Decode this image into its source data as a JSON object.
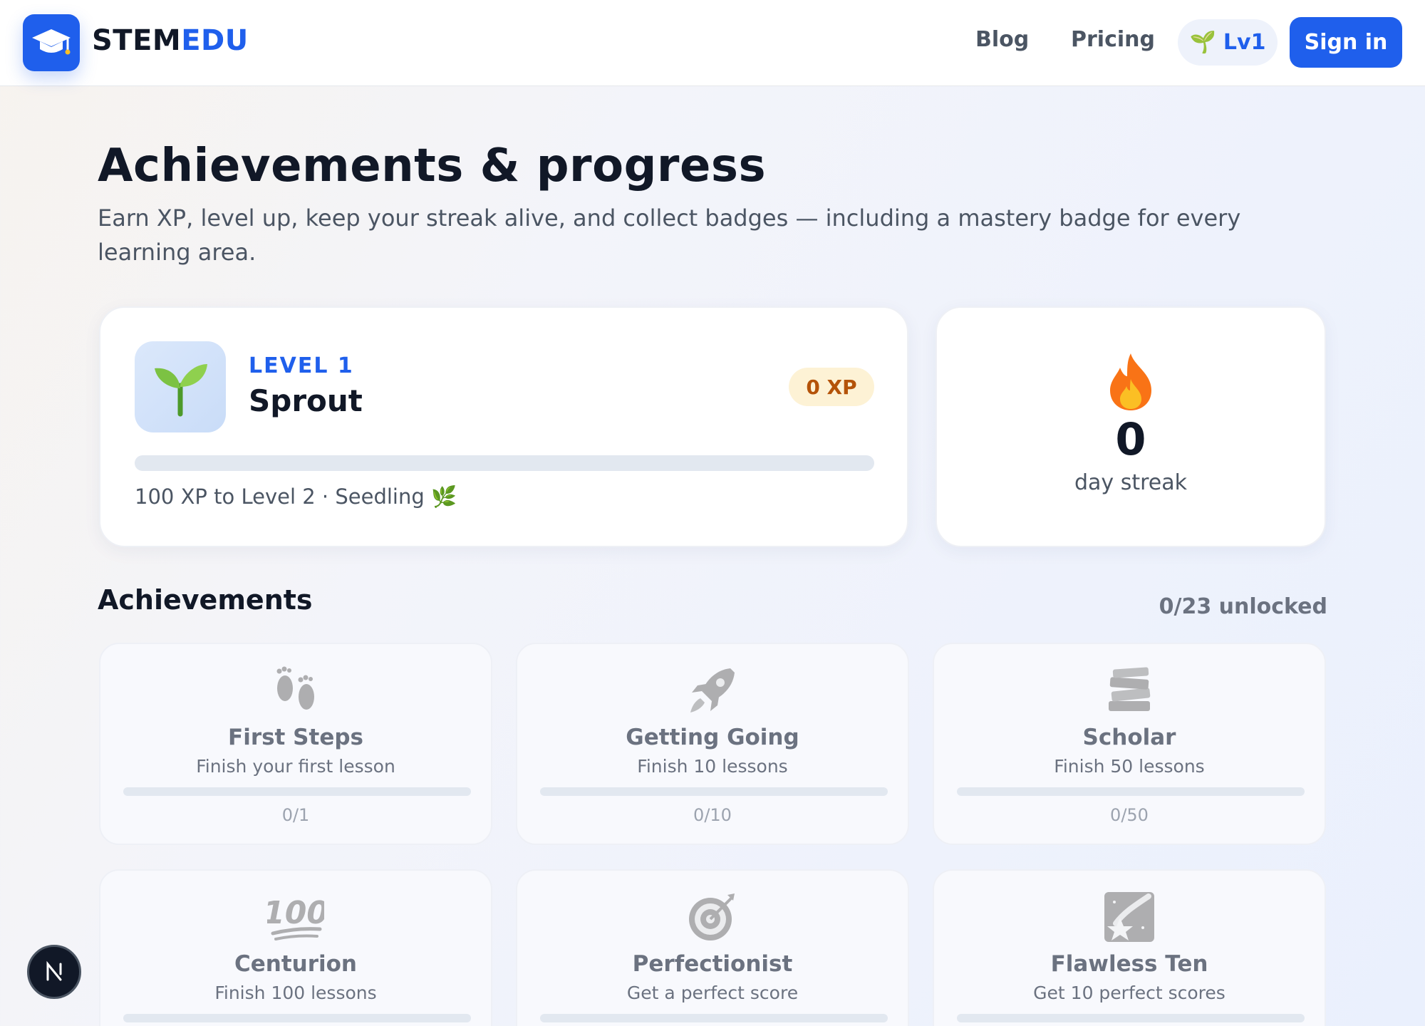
{
  "header": {
    "brand_part1": "STEM",
    "brand_part2": "EDU",
    "nav": [
      {
        "label": "Blog"
      },
      {
        "label": "Pricing"
      }
    ],
    "level_pill": "Lv1",
    "sign_in": "Sign in"
  },
  "page": {
    "title": "Achievements & progress",
    "subtitle": "Earn XP, level up, keep your streak alive, and collect badges — including a mastery badge for every learning area."
  },
  "level_card": {
    "level_label": "LEVEL 1",
    "level_name": "Sprout",
    "xp": "0 XP",
    "progress_fraction": 0,
    "next_text": "100 XP to Level 2 · Seedling 🌿"
  },
  "streak_card": {
    "count": "0",
    "label": "day streak"
  },
  "achievements": {
    "heading": "Achievements",
    "unlocked": "0/23 unlocked",
    "items": [
      {
        "icon": "footprints-icon",
        "title": "First Steps",
        "desc": "Finish your first lesson",
        "progress": "0/1",
        "fraction": 0
      },
      {
        "icon": "rocket-icon",
        "title": "Getting Going",
        "desc": "Finish 10 lessons",
        "progress": "0/10",
        "fraction": 0
      },
      {
        "icon": "books-icon",
        "title": "Scholar",
        "desc": "Finish 50 lessons",
        "progress": "0/50",
        "fraction": 0
      },
      {
        "icon": "hundred-icon",
        "title": "Centurion",
        "desc": "Finish 100 lessons",
        "progress": "",
        "fraction": 0
      },
      {
        "icon": "target-icon",
        "title": "Perfectionist",
        "desc": "Get a perfect score",
        "progress": "",
        "fraction": 0
      },
      {
        "icon": "shooting-star-icon",
        "title": "Flawless Ten",
        "desc": "Get 10 perfect scores",
        "progress": "",
        "fraction": 0
      }
    ]
  },
  "colors": {
    "accent": "#1f5fec",
    "xp_badge_bg": "#fdf2d5",
    "xp_badge_text": "#b45309"
  }
}
